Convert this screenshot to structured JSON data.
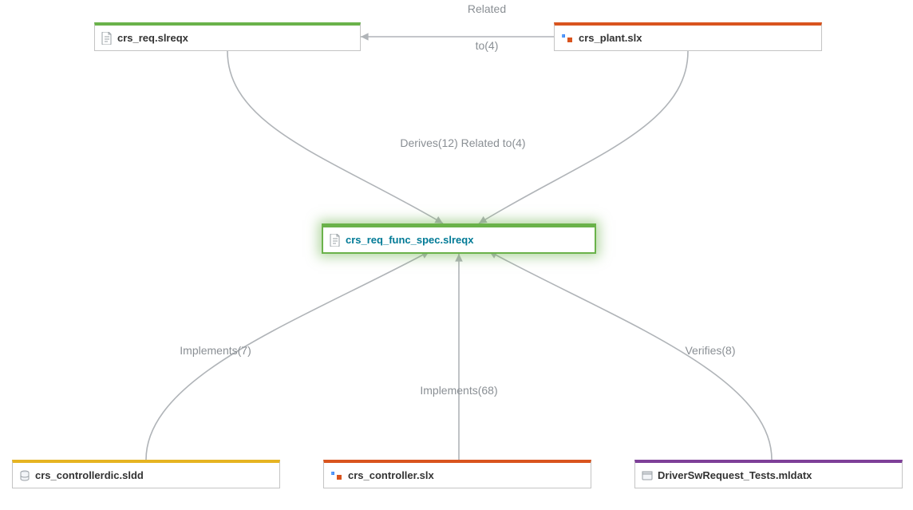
{
  "nodes": {
    "req": {
      "label": "crs_req.slreqx",
      "color": "#6ab24a",
      "icon": "doc"
    },
    "plant": {
      "label": "crs_plant.slx",
      "color": "#d9541e",
      "icon": "model"
    },
    "funcspec": {
      "label": "crs_req_func_spec.slreqx",
      "color": "#6ab24a",
      "icon": "doc"
    },
    "dict": {
      "label": "crs_controllerdic.sldd",
      "color": "#e6b422",
      "icon": "db"
    },
    "controller": {
      "label": "crs_controller.slx",
      "color": "#d9541e",
      "icon": "model"
    },
    "tests": {
      "label": "DriverSwRequest_Tests.mldatx",
      "color": "#7e3f98",
      "icon": "file"
    }
  },
  "edges": {
    "related_top_1": "Related",
    "related_top_2": "to(4)",
    "derives_related": "Derives(12) Related to(4)",
    "implements7": "Implements(7)",
    "implements68": "Implements(68)",
    "verifies8": "Verifies(8)"
  }
}
